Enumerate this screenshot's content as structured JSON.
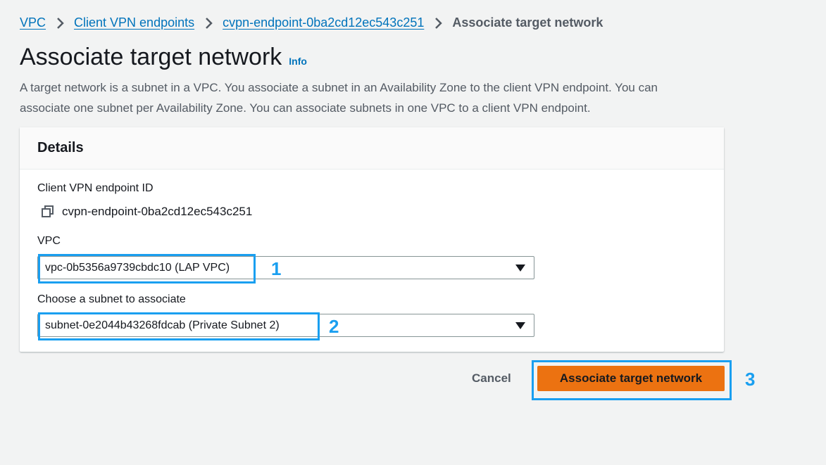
{
  "breadcrumb": {
    "items": [
      "VPC",
      "Client VPN endpoints",
      "cvpn-endpoint-0ba2cd12ec543c251"
    ],
    "current": "Associate target network"
  },
  "page": {
    "title": "Associate target network",
    "info_label": "Info",
    "description": "A target network is a subnet in a VPC. You associate a subnet in an Availability Zone to the client VPN endpoint. You can associate one subnet per Availability Zone. You can associate subnets in one VPC to a client VPN endpoint."
  },
  "details": {
    "header": "Details",
    "endpoint_label": "Client VPN endpoint ID",
    "endpoint_value": "cvpn-endpoint-0ba2cd12ec543c251",
    "vpc_label": "VPC",
    "vpc_value": "vpc-0b5356a9739cbdc10 (LAP VPC)",
    "subnet_label": "Choose a subnet to associate",
    "subnet_value": "subnet-0e2044b43268fdcab (Private Subnet 2)"
  },
  "actions": {
    "cancel_label": "Cancel",
    "submit_label": "Associate target network"
  },
  "annotations": {
    "step1": "1",
    "step2": "2",
    "step3": "3",
    "highlight_color": "#1a9ff0"
  },
  "colors": {
    "link": "#0073bb",
    "primary_button": "#ec7211",
    "background": "#f2f3f3"
  }
}
